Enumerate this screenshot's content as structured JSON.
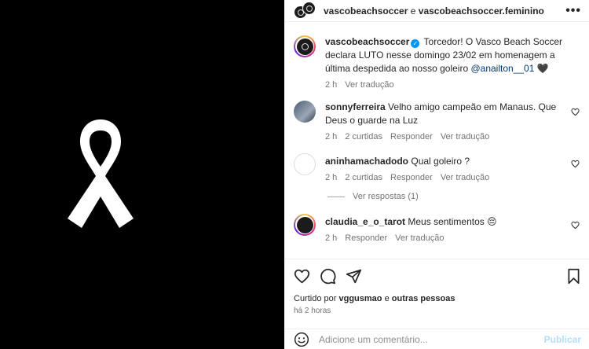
{
  "header": {
    "account_1": "vascobeachsoccer",
    "separator": "e",
    "account_2": "vascobeachsoccer.feminino",
    "more_icon": "more-horizontal-icon"
  },
  "caption": {
    "username": "vascobeachsoccer",
    "body": "Torcedor! O Vasco Beach Soccer declara LUTO nesse domingo 23/02 em homenagem a última despedida ao nosso goleiro",
    "mention": "@anailton__01",
    "emoji": "🖤",
    "time": "2 h",
    "translate": "Ver tradução"
  },
  "comments": [
    {
      "username": "sonnyferreira",
      "text": "Velho amigo campeão em Manaus. Que Deus o guarde na Luz",
      "time": "2 h",
      "likes": "2 curtidas",
      "reply": "Responder",
      "translate": "Ver tradução"
    },
    {
      "username": "aninhamachadodo",
      "text": "Qual goleiro ?",
      "time": "2 h",
      "likes": "2 curtidas",
      "reply": "Responder",
      "translate": "Ver tradução",
      "view_replies": "Ver respostas (1)"
    },
    {
      "username": "claudia_e_o_tarot",
      "text": "Meus sentimentos 😔",
      "time": "2 h",
      "reply": "Responder",
      "translate": "Ver tradução"
    }
  ],
  "liked_by": {
    "prefix": "Curtido por",
    "user": "vggusmao",
    "conj": "e",
    "others": "outras pessoas"
  },
  "posted": "há 2 horas",
  "compose": {
    "placeholder": "Adicione um comentário...",
    "publish": "Publicar"
  },
  "colors": {
    "accent": "#0095f6",
    "mention": "#00376b",
    "muted": "#737373",
    "media_bg": "#000000"
  }
}
